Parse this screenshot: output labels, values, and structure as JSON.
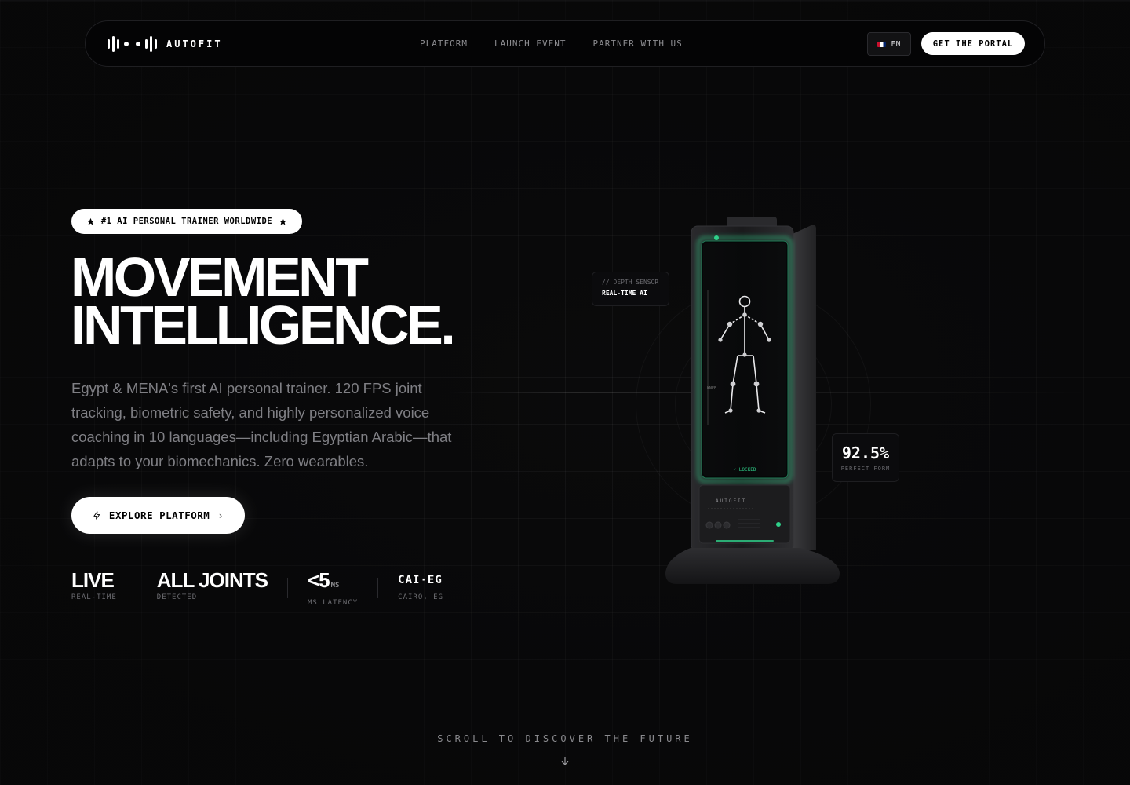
{
  "nav": {
    "brand": "AUTOFIT",
    "links": [
      "PLATFORM",
      "LAUNCH EVENT",
      "PARTNER WITH US"
    ],
    "language": "EN",
    "cta": "GET THE PORTAL"
  },
  "hero": {
    "badge": "#1 AI PERSONAL TRAINER WORLDWIDE",
    "headline_line1": "MOVEMENT",
    "headline_line2": "INTELLIGENCE.",
    "description": "Egypt & MENA's first AI personal trainer. 120 FPS joint tracking, biometric safety, and highly personalized voice coaching in 10 languages—including Egyptian Arabic—that adapts to your biomechanics. Zero wearables.",
    "explore_label": "EXPLORE PLATFORM"
  },
  "stats": [
    {
      "value": "LIVE",
      "unit": "",
      "label": "REAL-TIME"
    },
    {
      "value": "ALL JOINTS",
      "unit": "",
      "label": "DETECTED"
    },
    {
      "value": "<5",
      "unit": "MS",
      "label": "MS LATENCY"
    },
    {
      "value": "CAI·EG",
      "unit": "",
      "label": "CAIRO, EG"
    }
  ],
  "device": {
    "sensor_line1": "// DEPTH SENSOR",
    "sensor_line2": "REAL-TIME AI",
    "form_value": "92.5%",
    "form_label": "PERFECT FORM",
    "screen_status": "✓ LOCKED",
    "knee_label": "KNEE",
    "panel_brand": "AUTOFIT",
    "accent": "#2fd18a"
  },
  "scroll_hint": "SCROLL TO DISCOVER THE FUTURE"
}
